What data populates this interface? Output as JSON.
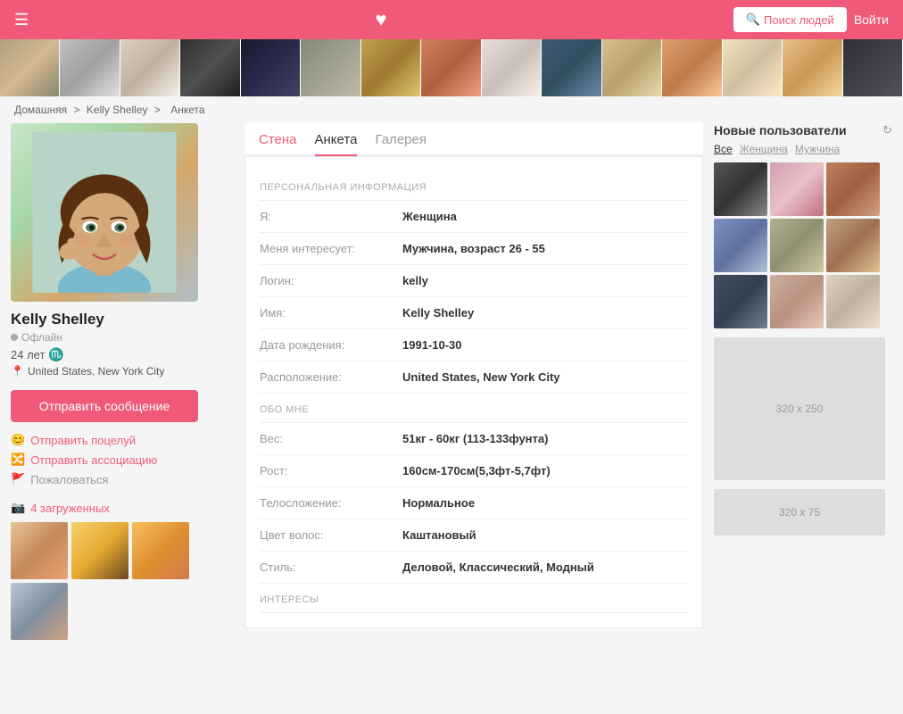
{
  "header": {
    "menu_icon": "☰",
    "heart_icon": "♥",
    "search_button": "Поиск людей",
    "login_button": "Войти"
  },
  "breadcrumb": {
    "home": "Домашняя",
    "separator1": ">",
    "user": "Kelly Shelley",
    "separator2": ">",
    "page": "Анкета"
  },
  "profile": {
    "name": "Kelly Shelley",
    "status": "Офлайн",
    "age": "24 лет",
    "zodiac": "♏",
    "location": "United States, New York City",
    "send_message": "Отправить сообщение",
    "send_kiss": "Отправить поцелуй",
    "send_association": "Отправить ассоциацию",
    "report": "Пожаловаться",
    "photos_count": "4 загруженных"
  },
  "tabs": {
    "wall": "Стена",
    "profile": "Анкета",
    "gallery": "Галерея"
  },
  "personal_info": {
    "section_title": "ПЕРСОНАЛЬНАЯ ИНФОРМАЦИЯ",
    "fields": [
      {
        "label": "Я:",
        "value": "Женщина"
      },
      {
        "label": "Меня интересует:",
        "value": "Мужчина, возраст 26 - 55"
      },
      {
        "label": "Логин:",
        "value": "kelly"
      },
      {
        "label": "Имя:",
        "value": "Kelly Shelley"
      },
      {
        "label": "Дата рождения:",
        "value": "1991-10-30"
      },
      {
        "label": "Расположение:",
        "value": "United States, New York City"
      }
    ]
  },
  "about_me": {
    "section_title": "ОБО МНЕ",
    "fields": [
      {
        "label": "Вес:",
        "value": "51кг - 60кг (113-133фунта)"
      },
      {
        "label": "Рост:",
        "value": "160см-170см(5,3фт-5,7фт)"
      },
      {
        "label": "Телосложение:",
        "value": "Нормальное"
      },
      {
        "label": "Цвет волос:",
        "value": "Каштановый"
      },
      {
        "label": "Стиль:",
        "value": "Деловой, Классический, Модный"
      }
    ]
  },
  "interests": {
    "section_title": "ИНТЕРЕСЫ"
  },
  "right_sidebar": {
    "title": "Новые пользователи",
    "refresh_icon": "↻",
    "filters": [
      "Все",
      "Женщина",
      "Мужчина"
    ],
    "ad1": "320 x 250",
    "ad2": "320 x 75"
  }
}
